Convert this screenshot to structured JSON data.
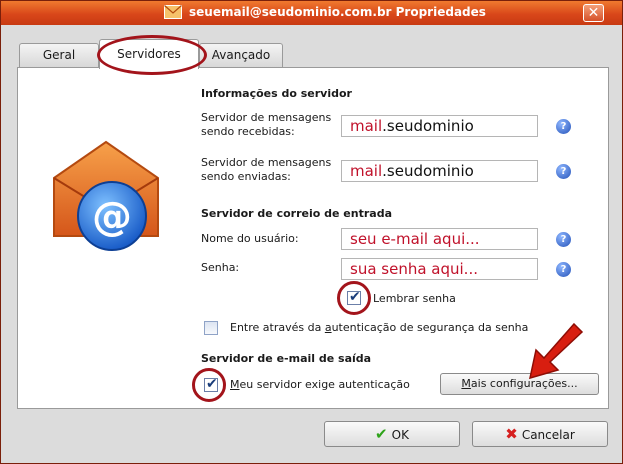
{
  "window": {
    "title": "seuemail@seudominio.com.br Propriedades",
    "close_glyph": "✕"
  },
  "tabs": [
    {
      "label": "Geral"
    },
    {
      "label": "Servidores"
    },
    {
      "label": "Avançado"
    }
  ],
  "server_info": {
    "heading": "Informações do servidor",
    "incoming_label_1": "Servidor de mensagens",
    "incoming_label_2": "sendo recebidas:",
    "incoming_value_red": "mail",
    "incoming_value_rest": ".seudominio",
    "outgoing_label_1": "Servidor de mensagens",
    "outgoing_label_2": "sendo enviadas:",
    "outgoing_value_red": "mail",
    "outgoing_value_rest": ".seudominio"
  },
  "incoming_mail": {
    "heading": "Servidor de correio de entrada",
    "username_label": "Nome do usuário:",
    "username_value": "seu e-mail aqui...",
    "password_label": "Senha:",
    "password_value": "sua senha aqui...",
    "remember_label": "Lembrar senha",
    "remember_checked": true,
    "spa_label_pre": "Entre através da ",
    "spa_label_u": "a",
    "spa_label_post": "utenticação de segurança da senha",
    "spa_checked": false
  },
  "outgoing_mail": {
    "heading": "Servidor de e-mail de saída",
    "auth_label_u": "M",
    "auth_label_rest": "eu servidor exige autenticação",
    "auth_checked": true,
    "more_settings_u": "M",
    "more_settings_rest": "ais configurações..."
  },
  "footer": {
    "ok_label": "OK",
    "cancel_label": "Cancelar"
  },
  "help_glyph": "?",
  "colors": {
    "title_bar": "#d9471a",
    "annotation": "#a3141b",
    "arrow": "#d81e10",
    "field_text": "#c0112a"
  },
  "icons": [
    "email-icon",
    "close-icon",
    "help-icon",
    "mail-at-icon",
    "checkmark-icon",
    "cross-icon",
    "arrow-annotation-icon"
  ]
}
